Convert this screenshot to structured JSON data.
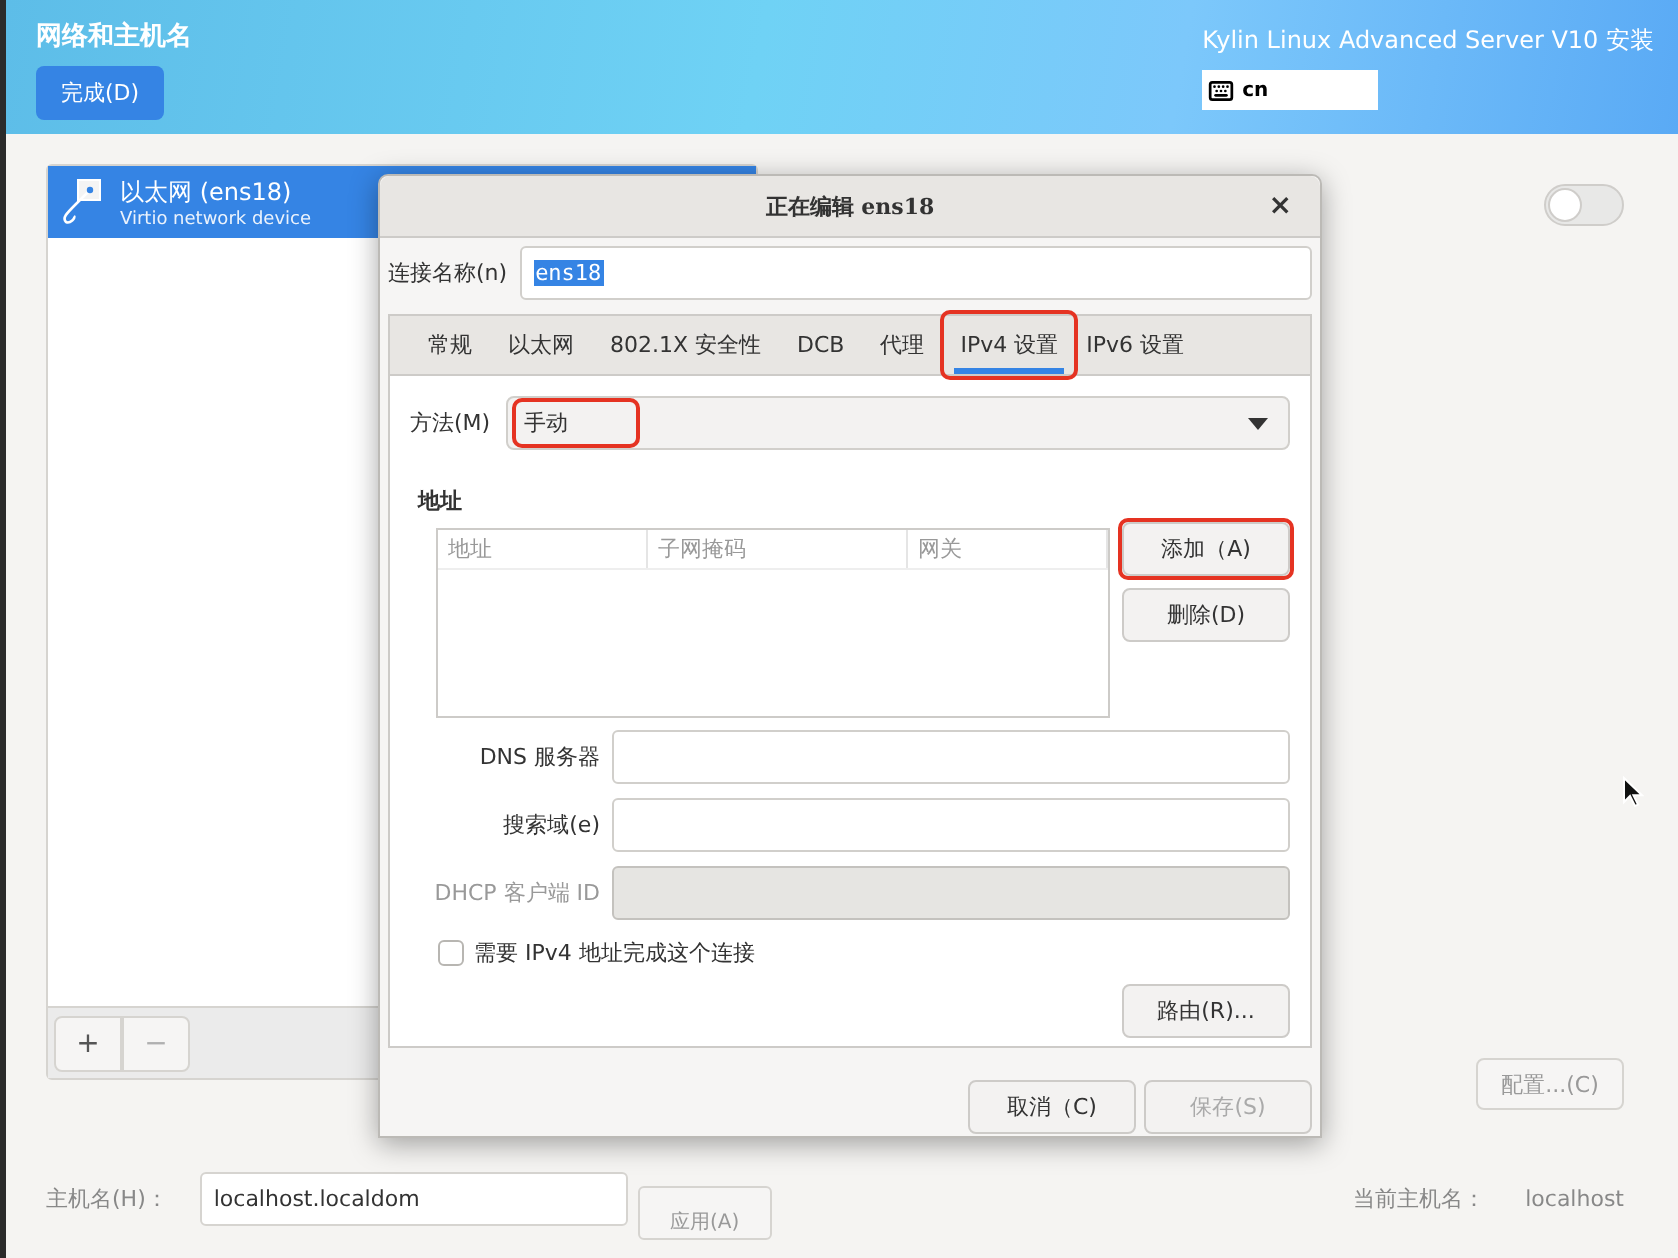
{
  "header": {
    "title": "网络和主机名",
    "done_button": "完成(D)",
    "product_title": "Kylin Linux Advanced Server V10 安装",
    "keyboard_layout": "cn"
  },
  "devices": [
    {
      "name": "以太网 (ens18)",
      "description": "Virtio network device",
      "selected": true
    }
  ],
  "device_toolbar": {
    "add": "+",
    "remove": "−",
    "remove_disabled": true
  },
  "device_switch": {
    "on": false
  },
  "configure_button": {
    "label": "配置...(C)",
    "disabled": true
  },
  "hostname": {
    "label": "主机名(H)：",
    "value": "localhost.localdom",
    "apply_button": "应用(A)"
  },
  "current_hostname": {
    "label": "当前主机名：",
    "value": "localhost"
  },
  "dialog": {
    "title": "正在编辑 ens18",
    "close": "×",
    "connection_name": {
      "label": "连接名称(n)",
      "value": "ens18",
      "text_selected": true
    },
    "tabs": [
      {
        "label": "常规",
        "selected": false,
        "highlighted": false
      },
      {
        "label": "以太网",
        "selected": false,
        "highlighted": false
      },
      {
        "label": "802.1X 安全性",
        "selected": false,
        "highlighted": false
      },
      {
        "label": "DCB",
        "selected": false,
        "highlighted": false
      },
      {
        "label": "代理",
        "selected": false,
        "highlighted": false
      },
      {
        "label": "IPv4 设置",
        "selected": true,
        "highlighted": true
      },
      {
        "label": "IPv6 设置",
        "selected": false,
        "highlighted": false
      }
    ],
    "method": {
      "label": "方法(M)",
      "value": "手动",
      "highlighted": true
    },
    "addresses": {
      "heading": "地址",
      "columns": [
        "地址",
        "子网掩码",
        "网关"
      ]
    },
    "add_button": {
      "label": "添加（A)",
      "highlighted": true
    },
    "delete_button": {
      "label": "删除(D)"
    },
    "fields": [
      {
        "label": "DNS 服务器",
        "disabled": false
      },
      {
        "label": "搜索域(e)",
        "disabled": false
      },
      {
        "label": "DHCP 客户端 ID",
        "disabled": true
      }
    ],
    "require_checkbox": {
      "label": "需要 IPv4 地址完成这个连接",
      "checked": false
    },
    "routes_button": "路由(R)...",
    "cancel_button": {
      "label": "取消（C)",
      "disabled": false
    },
    "save_button": {
      "label": "保存(S)",
      "disabled": true
    }
  }
}
